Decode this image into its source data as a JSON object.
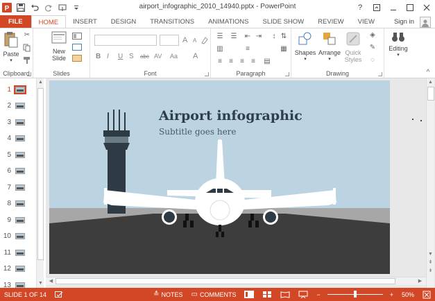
{
  "titlebar": {
    "app_icon": "powerpoint-icon",
    "title": "airport_infographic_2010_14940.pptx - PowerPoint",
    "help": "?",
    "qat_icons": [
      "save-icon",
      "undo-icon",
      "redo-icon",
      "touch-mode-icon",
      "customize-icon"
    ]
  },
  "tabs": [
    {
      "label": "FILE"
    },
    {
      "label": "HOME"
    },
    {
      "label": "INSERT"
    },
    {
      "label": "DESIGN"
    },
    {
      "label": "TRANSITIONS"
    },
    {
      "label": "ANIMATIONS"
    },
    {
      "label": "SLIDE SHOW"
    },
    {
      "label": "REVIEW"
    },
    {
      "label": "VIEW"
    }
  ],
  "signin": "Sign in",
  "ribbon": {
    "clipboard": {
      "label": "Clipboard",
      "paste": "Paste"
    },
    "slides": {
      "label": "Slides",
      "new_slide_line1": "New",
      "new_slide_line2": "Slide"
    },
    "font": {
      "label": "Font",
      "bold": "B",
      "italic": "I",
      "underline": "U",
      "shadow": "S",
      "strike": "abc",
      "spacing": "AV",
      "case": "Aa",
      "color": "A",
      "grow": "A",
      "shrink": "A"
    },
    "paragraph": {
      "label": "Paragraph"
    },
    "drawing": {
      "label": "Drawing",
      "shapes": "Shapes",
      "arrange": "Arrange",
      "quick_styles_line1": "Quick",
      "quick_styles_line2": "Styles"
    },
    "editing": {
      "label": "Editing"
    }
  },
  "thumbnails": [
    "1",
    "2",
    "3",
    "4",
    "5",
    "6",
    "7",
    "8",
    "9",
    "10",
    "11",
    "12",
    "13"
  ],
  "active_slide": 1,
  "slide": {
    "title": "Airport infographic",
    "subtitle": "Subtitle goes here"
  },
  "status": {
    "slide_info": "SLIDE 1 OF 14",
    "notes": "NOTES",
    "comments": "COMMENTS",
    "zoom": "50%",
    "zoom_fraction": 0.5
  },
  "colors": {
    "accent": "#d24726",
    "sky": "#bcd3e1",
    "ground": "#3d3d3d",
    "tower": "#2f3b44"
  }
}
